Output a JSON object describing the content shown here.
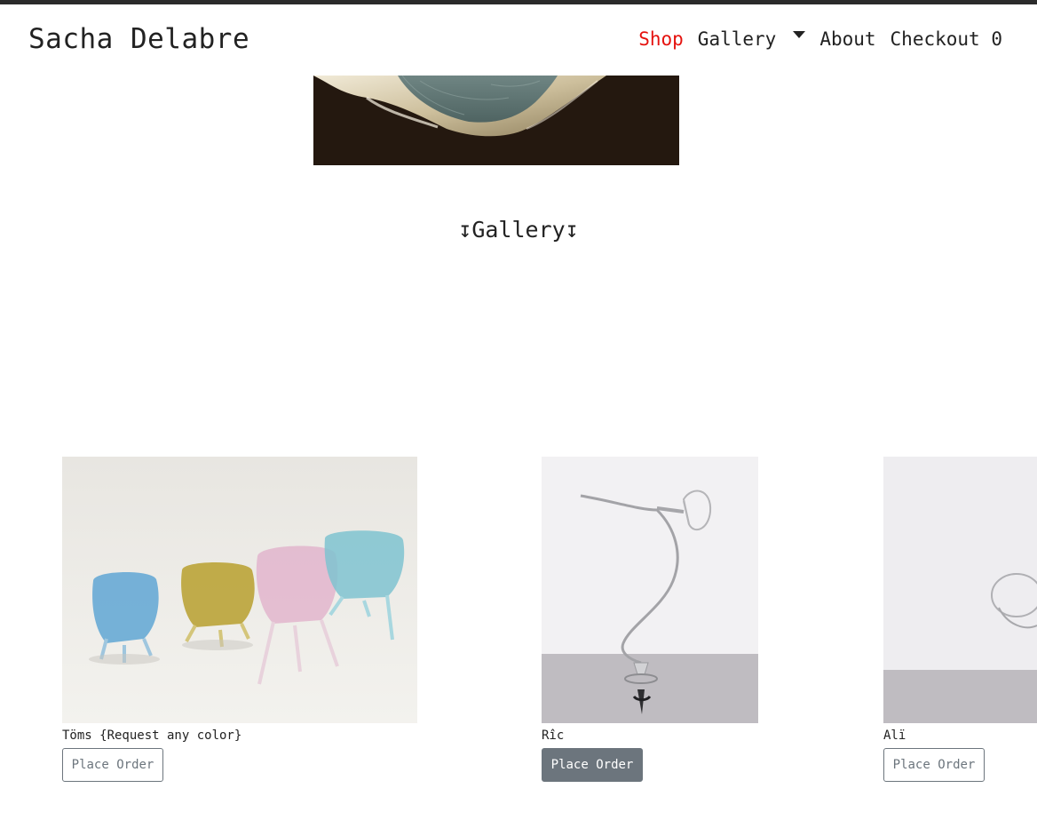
{
  "navbar": {
    "brand": "Sacha Delabre",
    "links": [
      {
        "label": "Shop",
        "active": true
      },
      {
        "label": "Gallery"
      },
      {
        "label": "About"
      },
      {
        "label": "Checkout"
      }
    ],
    "cart_count": "0",
    "accent_color": "#e5120e"
  },
  "section": {
    "title": "↧Gallery↧"
  },
  "products": [
    {
      "name": "Töms {Request any color}",
      "button": "Place Order",
      "button_style": "outline"
    },
    {
      "name": "Rîc",
      "button": "Place Order",
      "button_style": "filled"
    },
    {
      "name": "Alï",
      "button": "Place Order",
      "button_style": "outline"
    }
  ],
  "colors": {
    "button_gray": "#6c757d",
    "top_strip": "#2b2b2b"
  }
}
